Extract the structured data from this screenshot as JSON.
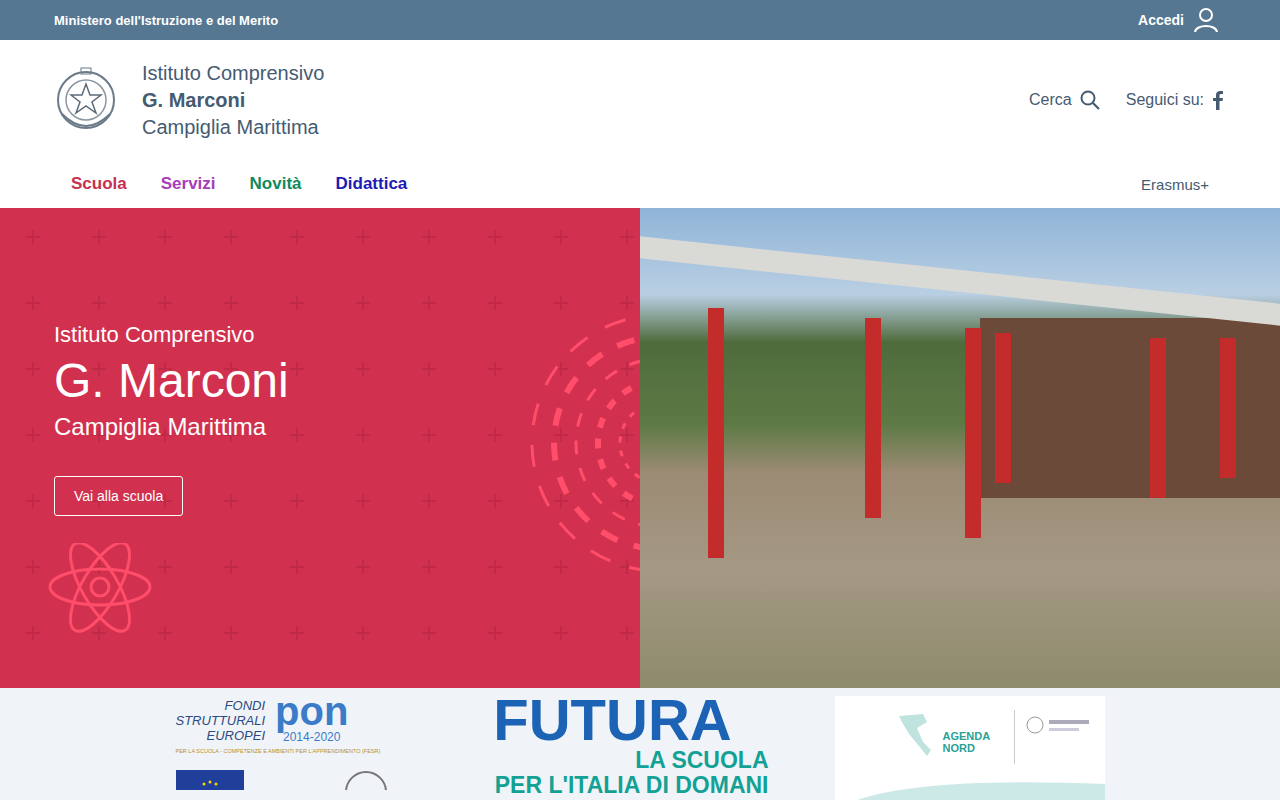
{
  "top_bar": {
    "ministry": "Ministero dell'Istruzione e del Merito",
    "login": "Accedi"
  },
  "header": {
    "school_type": "Istituto Comprensivo",
    "school_name": "G. Marconi",
    "city": "Campiglia Marittima",
    "search": "Cerca",
    "follow": "Seguici su:"
  },
  "nav": {
    "items": [
      {
        "label": "Scuola",
        "color": "#c4314f"
      },
      {
        "label": "Servizi",
        "color": "#a63db9"
      },
      {
        "label": "Novità",
        "color": "#0f8a5c"
      },
      {
        "label": "Didattica",
        "color": "#1c1cb5"
      }
    ],
    "extra": "Erasmus+"
  },
  "hero": {
    "subtitle": "Istituto Comprensivo",
    "title": "G. Marconi",
    "city": "Campiglia Marittima",
    "button": "Vai alla scuola"
  },
  "banners": {
    "pon": {
      "lines": [
        "FONDI",
        "STRUTTURALI",
        "EUROPEI"
      ],
      "logo": "pon",
      "years": "2014-2020",
      "caption": "PER LA SCUOLA - COMPETENZE E AMBIENTI PER L'APPRENDIMENTO (FESR)"
    },
    "futura": {
      "title": "FUTURA",
      "line1": "LA SCUOLA",
      "line2": "PER L'ITALIA DI DOMANI"
    },
    "agenda": {
      "line1": "AGENDA",
      "line2": "NORD"
    }
  }
}
